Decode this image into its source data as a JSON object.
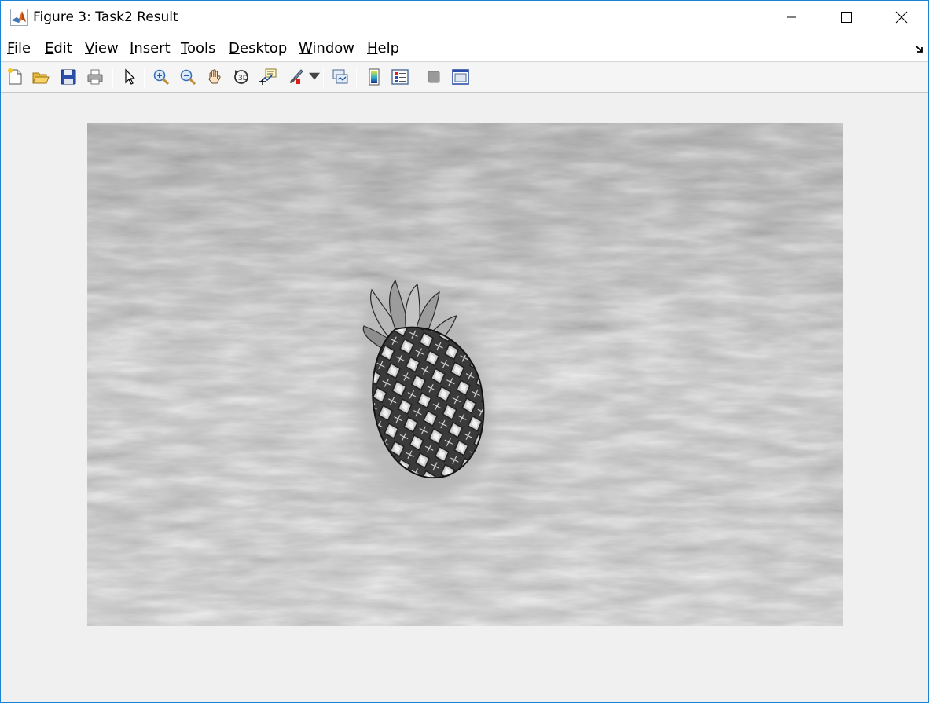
{
  "window": {
    "title": "Figure 3: Task2 Result"
  },
  "title_bar": {
    "icon": "matlab-logo-icon",
    "controls": [
      "minimize-icon",
      "maximize-icon",
      "close-icon"
    ]
  },
  "menu": {
    "items": [
      {
        "underline": "F",
        "rest": "ile"
      },
      {
        "underline": "E",
        "rest": "dit"
      },
      {
        "underline": "V",
        "rest": "iew"
      },
      {
        "underline": "I",
        "rest": "nsert"
      },
      {
        "underline": "T",
        "rest": "ools"
      },
      {
        "underline": "D",
        "rest": "esktop"
      },
      {
        "underline": "W",
        "rest": "indow"
      },
      {
        "underline": "H",
        "rest": "elp"
      }
    ],
    "dock_icon": "dock-arrow-icon"
  },
  "toolbar": {
    "groups": [
      [
        "new-figure-icon",
        "open-file-icon",
        "save-icon",
        "print-icon"
      ],
      [
        "pointer-icon"
      ],
      [
        "zoom-in-icon",
        "zoom-out-icon",
        "pan-icon",
        "rotate-3d-icon",
        "data-cursor-icon",
        "brush-icon"
      ],
      [
        "link-plot-icon"
      ],
      [
        "colorbar-icon",
        "legend-icon"
      ],
      [
        "hide-plot-tools-icon",
        "show-plot-tools-icon"
      ]
    ]
  },
  "figure": {
    "image_content": "grayscale photo: rippling water surface with a pineapple floating in the center",
    "colormap": "gray",
    "colors": {
      "window_border": "#1883d7",
      "figure_background": "#f0f0f0",
      "water_mid": "#9a9a9a"
    }
  }
}
